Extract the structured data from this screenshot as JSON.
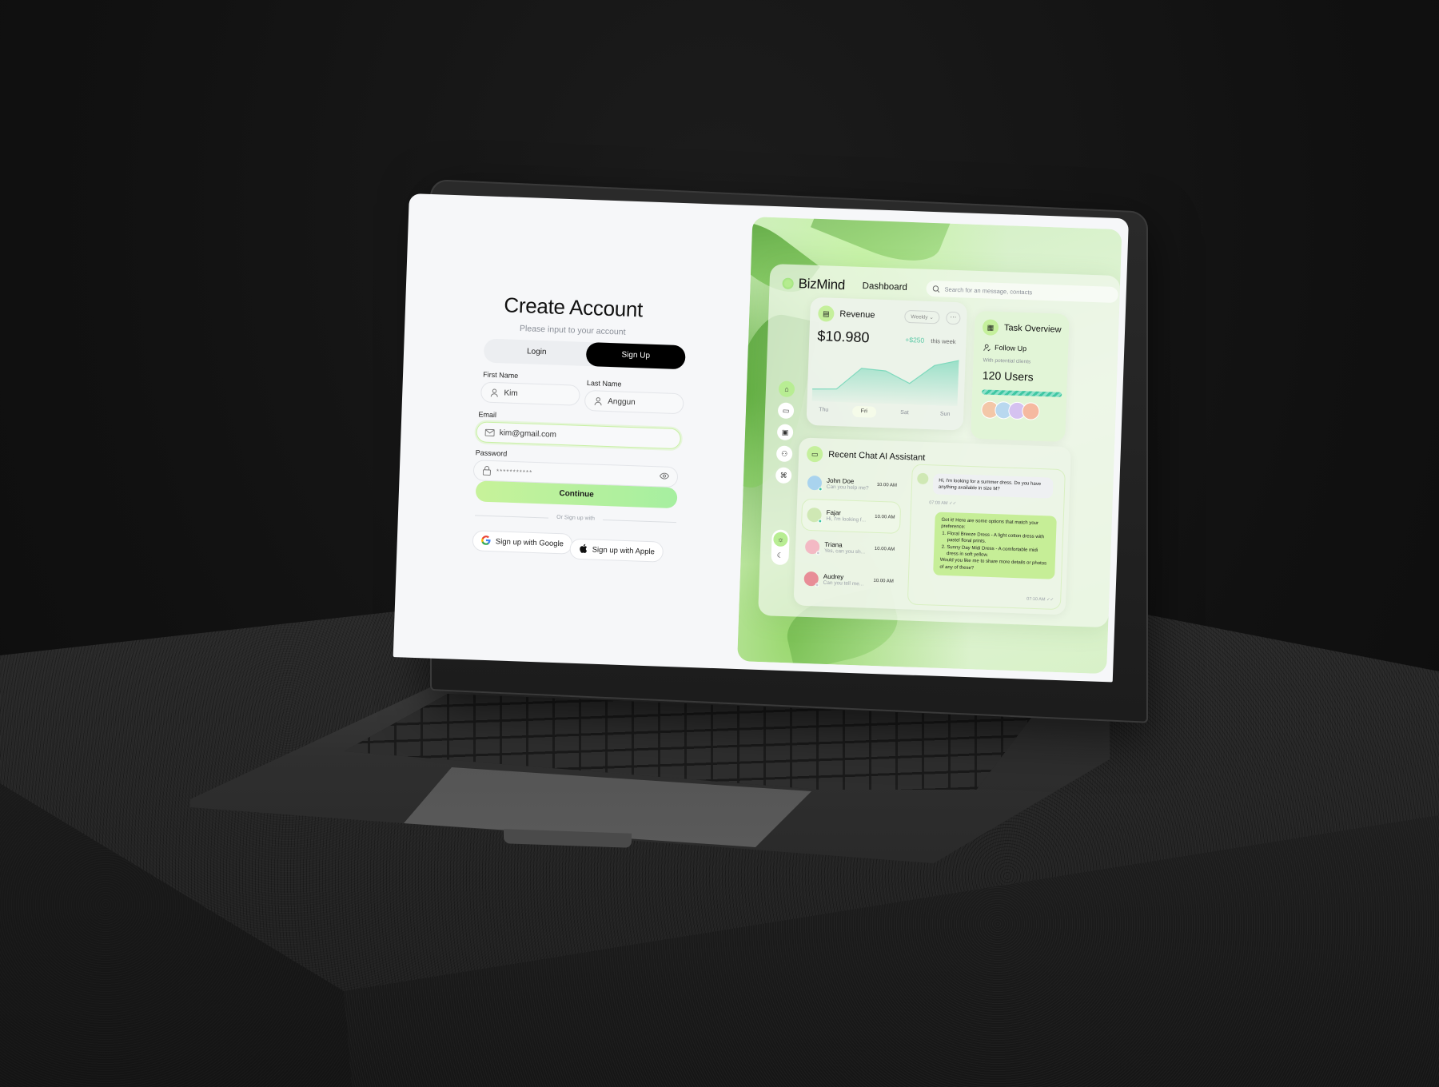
{
  "auth": {
    "title": "Create Account",
    "subtitle": "Please input to your account",
    "tabs": [
      {
        "label": "Login",
        "active": false
      },
      {
        "label": "Sign Up",
        "active": true
      }
    ],
    "fields": {
      "first_name": {
        "label": "First Name",
        "value": "Kim",
        "icon": "user-icon"
      },
      "last_name": {
        "label": "Last Name",
        "value": "Anggun",
        "icon": "user-icon"
      },
      "email": {
        "label": "Email",
        "value": "kim@gmail.com",
        "icon": "mail-icon"
      },
      "password": {
        "label": "Password",
        "value": "***********",
        "icon": "lock-icon",
        "toggle_icon": "eye-icon"
      }
    },
    "continue_label": "Continue",
    "divider_text": "Or Sign up with",
    "social": [
      {
        "label": "Sign up with Google",
        "icon": "google-icon"
      },
      {
        "label": "Sign up with Apple",
        "icon": "apple-icon"
      }
    ]
  },
  "dashboard": {
    "brand": "BizMind",
    "title": "Dashboard",
    "search_placeholder": "Search for an message, contacts",
    "nav": [
      {
        "icon": "home-icon",
        "glyph": "⌂",
        "active": true
      },
      {
        "icon": "chat-icon",
        "glyph": "▭",
        "active": false
      },
      {
        "icon": "calendar-icon",
        "glyph": "▣",
        "active": false
      },
      {
        "icon": "users-icon",
        "glyph": "⚇",
        "active": false
      },
      {
        "icon": "apps-icon",
        "glyph": "⌘",
        "active": false
      }
    ],
    "theme_toggle": {
      "light_glyph": "☼",
      "dark_glyph": "☾",
      "mode": "light"
    },
    "revenue": {
      "title": "Revenue",
      "period": "Weekly",
      "more_glyph": "···",
      "amount": "$10.980",
      "delta": "+$250",
      "delta_note": "this week",
      "selected_day": "Fri",
      "chart_data": {
        "type": "area",
        "x": [
          "Thu",
          "",
          "Fri",
          "",
          "Sat",
          "",
          "Sun"
        ],
        "values": [
          0.2,
          0.22,
          0.7,
          0.66,
          0.4,
          0.82,
          0.95
        ],
        "days": [
          "Thu",
          "Fri",
          "Sat",
          "Sun"
        ],
        "color": "#7fd9bd"
      }
    },
    "task_overview": {
      "title": "Task Overview",
      "item": "Follow Up",
      "note": "With potential clients",
      "count": "120 Users",
      "avatar_colors": [
        "#f3c7a8",
        "#b9d8ef",
        "#d5c2f0",
        "#f5b9a0"
      ]
    },
    "recent_chat": {
      "title": "Recent Chat AI Assistant",
      "items": [
        {
          "name": "John Doe",
          "preview": "Can you help me?",
          "time": "10.00 AM",
          "online": true,
          "avatar": "#a9d3ee"
        },
        {
          "name": "Fajar",
          "preview": "Hi, I'm looking f...",
          "time": "10.00 AM",
          "online": true,
          "avatar": "#cfe8b4",
          "selected": true
        },
        {
          "name": "Triana",
          "preview": "Yes, can you sh...",
          "time": "10.00 AM",
          "online": false,
          "avatar": "#f3b9c4"
        },
        {
          "name": "Audrey",
          "preview": "Can you tell me...",
          "time": "10.00 AM",
          "online": false,
          "avatar": "#e88d97"
        }
      ],
      "conversation": {
        "incoming": "Hi, I'm looking for a summer dress. Do you have anything available in size M?",
        "incoming_time": "07:00 AM",
        "outgoing_intro": "Got it! Here are some options that match your preference:",
        "outgoing_list": [
          "Floral Breeze Dress - A light cotton dress with pastel floral prints.",
          "Sunny Day Midi Dress - A comfortable midi dress in soft yellow."
        ],
        "outgoing_outro": "Would you like me to share more details or photos of any of these?",
        "outgoing_time": "07:10 AM",
        "read_glyph": "✓✓"
      }
    }
  }
}
